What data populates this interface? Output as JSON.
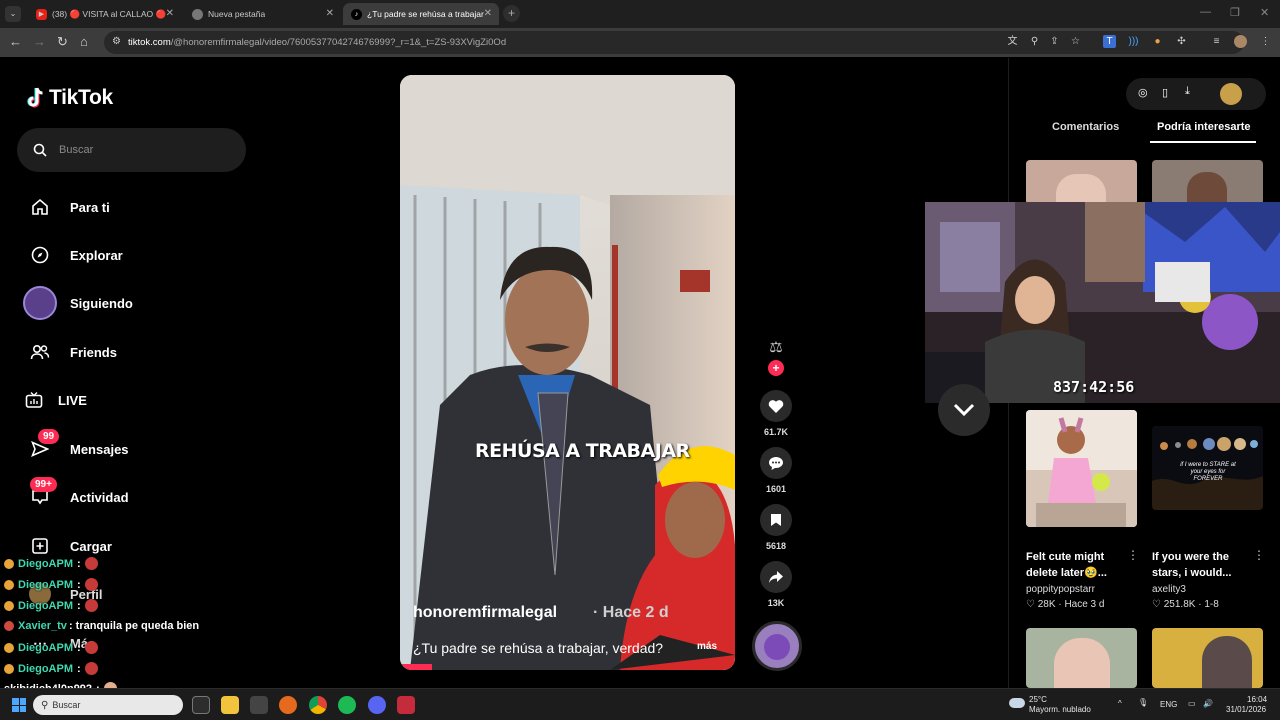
{
  "browser": {
    "tabs": [
      {
        "label": "(38) 🔴 VISITA al CALLAO 🔴",
        "icon": "youtube-icon"
      },
      {
        "label": "Nueva pestaña",
        "icon": "chrome-icon"
      },
      {
        "label": "¿Tu padre se rehúsa a trabajar",
        "icon": "tiktok-icon"
      }
    ],
    "url_host": "tiktok.com",
    "url_path": "/@honoremfirmalegal/video/7600537704274676999?_r=1&_t=ZS-93XVigZi0Od"
  },
  "tiktok": {
    "logo_text": "TikTok",
    "search_placeholder": "Buscar",
    "nav": [
      {
        "label": "Para ti",
        "icon": "home-icon"
      },
      {
        "label": "Explorar",
        "icon": "compass-icon"
      },
      {
        "label": "Siguiendo",
        "icon": "avatar-icon"
      },
      {
        "label": "Friends",
        "icon": "friends-icon"
      },
      {
        "label": "LIVE",
        "icon": "live-tv-icon"
      },
      {
        "label": "Mensajes",
        "icon": "send-icon",
        "badge": "99"
      },
      {
        "label": "Actividad",
        "icon": "inbox-icon",
        "badge": "99+"
      },
      {
        "label": "Cargar",
        "icon": "upload-plus-icon"
      },
      {
        "label": "Perfil",
        "icon": "profile-icon"
      },
      {
        "label": "Más",
        "icon": "more-icon"
      }
    ],
    "video": {
      "author": "honoremfirmalegal",
      "ago": "· Hace 2 d",
      "description": "¿Tu padre se rehúsa a trabajar, verdad?",
      "more": "más",
      "caption": "REHÚSA A TRABAJAR",
      "likes": "61.7K",
      "comments": "1601",
      "saves": "5618",
      "shares": "13K"
    },
    "panel": {
      "tab_comments": "Comentarios",
      "tab_suggested": "Podría interesarte",
      "videos": [
        {
          "title": "Felt cute might delete later🥹...",
          "author": "poppitypopstarr",
          "likes": "28K",
          "when": "Hace 3 d"
        },
        {
          "title": "If you were the stars, i would...",
          "author": "axelity3",
          "likes": "251.8K",
          "when": "1-8"
        }
      ],
      "thumb2_text": "if I were to STARE at your eyes for FOREVER"
    }
  },
  "stream": {
    "timer": "837:42:56"
  },
  "chat": [
    {
      "name": "DiegoAPM",
      "msg": ":",
      "color": "#e8a33a"
    },
    {
      "name": "DiegoAPM",
      "msg": ":",
      "color": "#e8a33a"
    },
    {
      "name": "DiegoAPM",
      "msg": ":",
      "color": "#e8a33a"
    },
    {
      "name": "Xavier_tv",
      "msg": ": tranquila pe queda bien",
      "color": "#d04b3d"
    },
    {
      "name": "DiegoAPM",
      "msg": ":",
      "color": "#e8a33a"
    },
    {
      "name": "DiegoAPM",
      "msg": ":",
      "color": "#e8a33a"
    },
    {
      "name": "skibidich4l0n992",
      "msg": ":",
      "color": "#ffffff"
    }
  ],
  "taskbar": {
    "search": "Buscar",
    "weather_temp": "25°C",
    "weather_desc": "Mayorm. nublado",
    "lang": "ENG",
    "time": "16:04",
    "date": "31/01/2026"
  }
}
